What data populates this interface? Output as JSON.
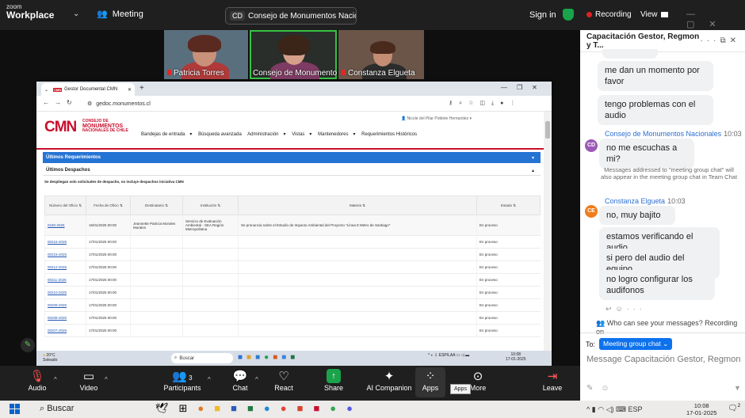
{
  "zoom_app": {
    "logo_top": "zoom",
    "logo_bottom": "Workplace",
    "meeting_label": "Meeting",
    "title_initials": "CD",
    "title_text": "Consejo de Monumentos Nacior",
    "sign_in": "Sign in",
    "recording": "Recording",
    "view": "View",
    "colors": {
      "recording": "#e02020",
      "shield": "#19a34a",
      "active_speaker": "#36c244",
      "accent": "#0e72ed"
    }
  },
  "participants": [
    {
      "name": "Patricia Torres"
    },
    {
      "name": "Consejo de Monumento..."
    },
    {
      "name": "Constanza Elgueta"
    }
  ],
  "browser": {
    "tab_title": "Gestor Documental CMN",
    "tab_favicon": "CMN",
    "url": "gedoc.monumentos.cl"
  },
  "cmn": {
    "logo": "CMN",
    "logo_sub_small": "CONSEJO DE",
    "logo_sub_big1": "MONUMENTOS",
    "logo_sub_big2": "NACIONALES DE CHILE",
    "user": "Nicole del Pilar Poblete Hernandez",
    "menu": [
      "Bandejas de entrada",
      "Búsqueda avanzada",
      "Administración",
      "Vistas",
      "Mantenedores",
      "Requerimientos Históricos"
    ],
    "section1": "Últimos Requerimientos",
    "section2": "Últimos Despachos",
    "note": "Se despliegan solo solicitudes de despacho, no incluye despachos iniciativa CMN",
    "headers": [
      "Número del Oficio",
      "Fecha de Oficio",
      "Destinatario",
      "Institución",
      "Materia",
      "Estado"
    ],
    "rows": [
      [
        "0180-2025",
        "16/01/2025 00:00",
        "Jeannette Patricia Morales Morales",
        "Servicio de Evaluación Ambiental - SEA Región Metropolitana",
        "Se pronuncia sobre el Estudio de Impacto Ambiental del Proyecto \"Línea 8 Metro de Santiago\"",
        "En proceso"
      ],
      [
        "00216-2025",
        "17/01/2025 00:00",
        "",
        "",
        "",
        "En proceso"
      ],
      [
        "00215-2025",
        "17/01/2025 00:00",
        "",
        "",
        "",
        "En proceso"
      ],
      [
        "00212-2025",
        "17/01/2025 00:00",
        "",
        "",
        "",
        "En proceso"
      ],
      [
        "00211-2025",
        "17/01/2025 00:00",
        "",
        "",
        "",
        "En proceso"
      ],
      [
        "00210-2025",
        "17/01/2025 00:00",
        "",
        "",
        "",
        "En proceso"
      ],
      [
        "00209-2025",
        "17/01/2025 00:00",
        "",
        "",
        "",
        "En proceso"
      ],
      [
        "00208-2025",
        "17/01/2025 00:00",
        "",
        "",
        "",
        "En proceso"
      ],
      [
        "00207-2025",
        "17/01/2025 00:00",
        "",
        "",
        "",
        "En proceso"
      ]
    ]
  },
  "inner_taskbar": {
    "temp": "20°C",
    "weather": "Soleado",
    "search": "Buscar",
    "lang1": "ESP",
    "lang2": "LAA",
    "time": "10:08",
    "date": "17-01-2025"
  },
  "toolbar": {
    "audio": "Audio",
    "video": "Video",
    "participants": "Participants",
    "participants_count": "3",
    "chat": "Chat",
    "react": "React",
    "share": "Share",
    "ai": "AI Companion",
    "apps": "Apps",
    "more": "More",
    "leave": "Leave",
    "apps_tooltip": "Apps"
  },
  "chat": {
    "title": "Capacitación Gestor, Regmon y T...",
    "messages": [
      "me dan un momento por favor",
      "tengo problemas con el audio"
    ],
    "sender1": "Consejo de Monumentos Nacionales",
    "sender1_time": "10:03",
    "sender1_initials": "CD",
    "sender1_msg": "no me escuchas a mi?",
    "system_msg": "Messages addressed to \"meeting group chat\" will also appear in the meeting group chat in Team Chat",
    "sender2": "Constanza Elgueta",
    "sender2_time": "10:03",
    "sender2_initials": "CE",
    "sender2_msgs": [
      "no, muy bajito",
      "estamos verificando el audio",
      "si pero del audio del equipo",
      "no logro configurar los audifonos"
    ],
    "who_can_see": "Who can see your messages? Recording on",
    "to_label": "To:",
    "to_value": "Meeting group chat",
    "input_placeholder": "Message Capacitación Gestor, Regmon y..."
  },
  "windows": {
    "search": "Buscar",
    "lang": "ESP",
    "time": "10:08",
    "date": "17-01-2025",
    "notif_count": "2"
  }
}
